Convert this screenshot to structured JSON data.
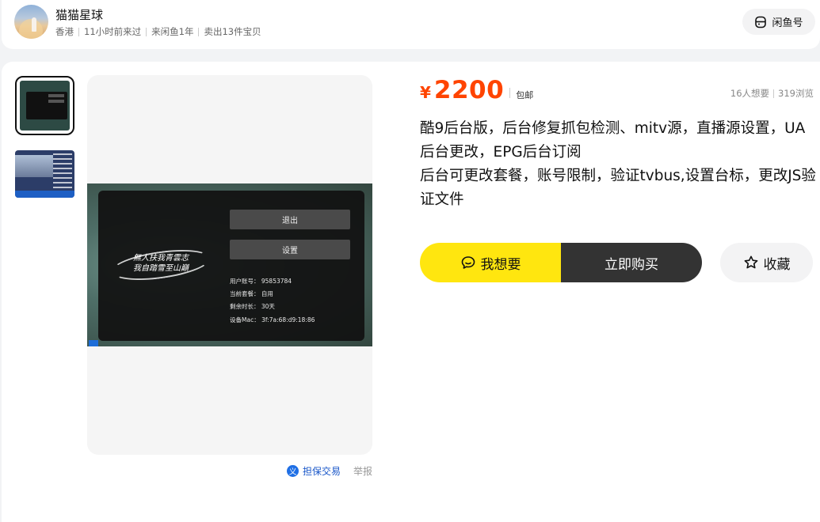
{
  "seller": {
    "name": "猫猫星球",
    "location": "香港",
    "last_seen": "11小时前来过",
    "joined": "来闲鱼1年",
    "sold": "卖出13件宝贝",
    "xianyu_label": "闲鱼号"
  },
  "product_image": {
    "exit_label": "退出",
    "settings_label": "设置",
    "slogan_line1": "無人扶我青雲志",
    "slogan_line2": "我自踏雪至山巔",
    "account": "用户账号：  95853784",
    "package": "当前套餐：  自用",
    "remaining": "剩余时长：  30天",
    "mac": "设备Mac：  3f:7a:68:d9:18:86"
  },
  "footer": {
    "guarantee_label": "担保交易",
    "guarantee_badge": "义",
    "report_label": "举报"
  },
  "listing": {
    "currency": "¥",
    "price": "2200",
    "shipping": "包邮",
    "wants": "16人想要",
    "views": "319浏览",
    "description_line1": "酷9后台版，后台修复抓包检测、mitv源，直播源设置，UA后台更改，EPG后台订阅",
    "description_line2": "后台可更改套餐，账号限制，验证tvbus,设置台标，更改JS验证文件"
  },
  "actions": {
    "want_label": "我想要",
    "buy_label": "立即购买",
    "favorite_label": "收藏"
  },
  "colors": {
    "price": "#ff4400",
    "want_button": "#ffe60f",
    "buy_button": "#333333",
    "guarantee": "#1a57c9"
  },
  "icons": {
    "xianyu": "xianyu-logo-icon",
    "want": "chat-bubble-icon",
    "favorite": "star-outline-icon",
    "guarantee": "guarantee-badge-icon"
  }
}
